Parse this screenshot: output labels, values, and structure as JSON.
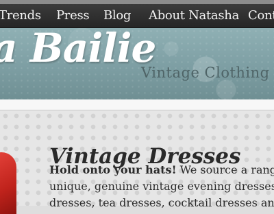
{
  "nav": {
    "items": [
      "Trends",
      "Press",
      "Blog",
      "About Natasha",
      "Cont"
    ]
  },
  "header": {
    "site_name": "a Bailie",
    "tagline": "Vintage Clothing C"
  },
  "main": {
    "title": "Vintage Dresses",
    "intro_bold": "Hold onto your hats!",
    "intro_rest": " We source a range",
    "line2": "unique, genuine vintage evening dresses",
    "line3": "dresses, tea dresses, cocktail dresses and"
  },
  "colors": {
    "navbar": "#2e2e2e",
    "banner": "#8fb0b4",
    "accent_dress": "#c0231c"
  }
}
